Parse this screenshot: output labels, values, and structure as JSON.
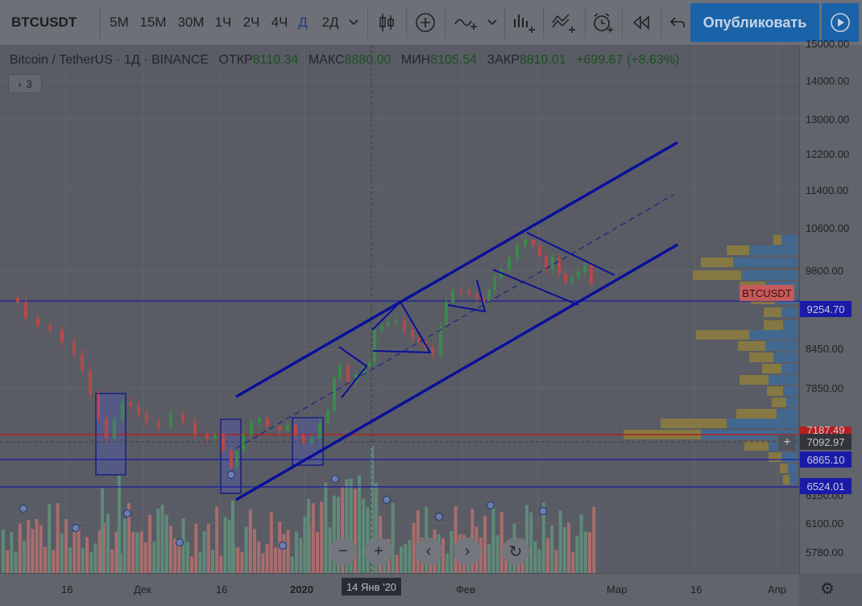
{
  "toolbar": {
    "symbol": "BTCUSDT",
    "timeframes": [
      "5М",
      "15М",
      "30М",
      "1Ч",
      "2Ч",
      "4Ч",
      "Д",
      "2Д"
    ],
    "active_timeframe": "Д",
    "publish_label": "Опубликовать",
    "icons": [
      "chevron-down-icon",
      "candles-icon",
      "plus-circle-icon",
      "indicators-icon",
      "chevron-down-icon",
      "bar-chart-plus-icon",
      "compare-icon",
      "alert-clock-icon",
      "replay-icon",
      "undo-icon",
      "play-icon"
    ]
  },
  "legend": {
    "title": "Bitcoin / TetherUS · 1Д · BINANCE",
    "open_label": "ОТКР",
    "open": "8110.34",
    "high_label": "МАКС",
    "high": "8880.00",
    "low_label": "МИН",
    "low": "8105.54",
    "close_label": "ЗАКР",
    "close": "8810.01",
    "change": "+699.67 (+8.63%)",
    "indicators_count": "3"
  },
  "price_scale": {
    "ticks": [
      "15000.00",
      "14000.00",
      "13000.00",
      "12200.00",
      "11400.00",
      "10600.00",
      "9800.00",
      "8450.00",
      "7850.00",
      "6150.00",
      "6100.00",
      "5780.00"
    ],
    "labels": [
      {
        "text": "BTCUSDT",
        "color": "#c65a5a"
      },
      {
        "text": "9254.70",
        "color": "#1a1aa8"
      },
      {
        "text": "7187.49",
        "color": "#b42020"
      },
      {
        "text": "7092.97",
        "color": "#33353b"
      },
      {
        "text": "6865.10",
        "color": "#1a1aa8"
      },
      {
        "text": "6524.01",
        "color": "#1a1aa8"
      }
    ]
  },
  "time_scale": {
    "ticks": [
      "16",
      "Дек",
      "16",
      "2020",
      "Фев",
      "Мар",
      "16",
      "Апр"
    ],
    "cursor_label": "14 Янв '20"
  },
  "nav": {
    "zoom_out": "−",
    "zoom_in": "+",
    "back": "‹",
    "forward": "›",
    "reset": "↻"
  },
  "colors": {
    "up": "#3b8a4a",
    "down": "#b64848",
    "channel": "#0a0f9a",
    "hline_red": "#b42020",
    "hline_blue": "#1a1aa8"
  }
}
